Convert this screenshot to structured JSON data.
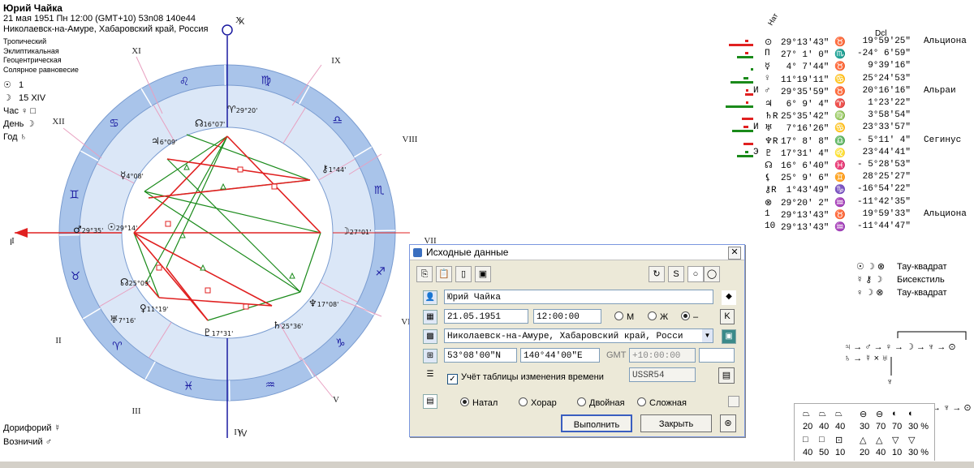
{
  "person": {
    "name": "Юрий Чайка",
    "datetime_line": "21 мая 1951  Пн  12:00 (GMT+10) 53n08  140e44",
    "place_line": "Николаевск-на-Амуре, Хабаровский край, Россия"
  },
  "settings": [
    "Тропический",
    "Эклиптикальная",
    "Геоцентрическая",
    "Солярное равновесие"
  ],
  "day_info": [
    {
      "glyph": "☉",
      "text": "1"
    },
    {
      "glyph": "☽",
      "text": "15 XIV"
    },
    {
      "label": "Час",
      "text": "♀ □"
    },
    {
      "label": "День",
      "text": "☽"
    },
    {
      "label": "Год",
      "text": "♄"
    }
  ],
  "bottom_left": [
    {
      "label": "Дорифорий",
      "glyph": "☿"
    },
    {
      "label": "Возничий",
      "glyph": "♂"
    }
  ],
  "chart": {
    "house_labels": [
      "X",
      "XI",
      "XII",
      "I",
      "II",
      "III",
      "IV",
      "V",
      "VI",
      "VII",
      "VIII",
      "IX"
    ],
    "zodiac": [
      "♉",
      "♈",
      "♓",
      "♒",
      "♑",
      "♐",
      "♏",
      "♎",
      "♍",
      "♌",
      "♋",
      "♊"
    ],
    "planet_labels": [
      {
        "glyph": "♈",
        "text": "29°20'"
      },
      {
        "glyph": "☊",
        "text": "16°07'"
      },
      {
        "glyph": "♃",
        "text": "6°09'"
      },
      {
        "glyph": "☿",
        "text": "4°08'"
      },
      {
        "glyph": "♂",
        "text": "29°35'"
      },
      {
        "glyph": "☉",
        "text": "29°14'"
      },
      {
        "glyph": "☊",
        "text": "25°09'"
      },
      {
        "glyph": "♅",
        "text": "7°16'"
      },
      {
        "glyph": "♀",
        "text": "11°19'"
      },
      {
        "glyph": "♇",
        "text": "17°31'"
      },
      {
        "glyph": "♄",
        "text": "25°36'"
      },
      {
        "glyph": "♆",
        "text": "17°08'"
      },
      {
        "glyph": "☽",
        "text": "27°01'"
      },
      {
        "glyph": "⚷",
        "text": "1°44'"
      }
    ],
    "axis_labels": {
      "x": "X",
      "i": "I",
      "iv": "IV",
      "vii": "VII"
    },
    "colors": {
      "ring": "#a9c4ea",
      "inner": "#dbe7f7",
      "hard": "#e02020",
      "soft": "#1a8a1a",
      "axis": "#1a1aa0",
      "asc": "#e02020"
    }
  },
  "table": {
    "header_nat": "Нат",
    "header_dcl": "Dcl",
    "rows": [
      {
        "mark": "",
        "glyph": "⊙",
        "pos": "29°13'43\" ♉",
        "dcl": " 19°59'25\"",
        "star": "Альциона",
        "bars": [
          {
            "c": "#e02020",
            "w": 30
          },
          {
            "c": "#e02020",
            "w": 4
          }
        ]
      },
      {
        "mark": "",
        "glyph": "Π",
        "pos": "27° 1' 0\" ♏",
        "dcl": "-24° 6'59\"",
        "star": "",
        "bars": [
          {
            "c": "#1a8a1a",
            "w": 20
          },
          {
            "c": "#e02020",
            "w": 4
          }
        ]
      },
      {
        "mark": "",
        "glyph": "☿",
        "pos": " 4° 7'44\" ♉",
        "dcl": "  9°39'16\"",
        "star": "",
        "bars": [
          {
            "c": "#1a8a1a",
            "w": 3
          }
        ]
      },
      {
        "mark": "",
        "glyph": "♀",
        "pos": "11°19'11\" ♋",
        "dcl": " 25°24'53\"",
        "star": "",
        "bars": [
          {
            "c": "#1a8a1a",
            "w": 28
          },
          {
            "c": "#1a8a1a",
            "w": 6
          }
        ]
      },
      {
        "mark": "И",
        "glyph": "♂",
        "pos": "29°35'59\" ♉",
        "dcl": " 20°16'16\"",
        "star": "Альраи",
        "bars": [
          {
            "c": "#e02020",
            "w": 10
          },
          {
            "c": "#e02020",
            "w": 3
          }
        ]
      },
      {
        "mark": "",
        "glyph": "♃",
        "pos": " 6° 9' 4\" ♈",
        "dcl": "  1°23'22\"",
        "star": "",
        "bars": [
          {
            "c": "#1a8a1a",
            "w": 34
          },
          {
            "c": "#e02020",
            "w": 3
          }
        ]
      },
      {
        "mark": "",
        "glyph": "♄R",
        "pos": "25°35'42\" ♍",
        "dcl": "  3°58'54\"",
        "star": "",
        "bars": [
          {
            "c": "#e02020",
            "w": 14
          }
        ]
      },
      {
        "mark": "И",
        "glyph": "♅",
        "pos": " 7°16'26\" ♋",
        "dcl": " 23°33'57\"",
        "star": "",
        "bars": [
          {
            "c": "#1a8a1a",
            "w": 26
          },
          {
            "c": "#e02020",
            "w": 6
          }
        ]
      },
      {
        "mark": "",
        "glyph": "♆R",
        "pos": "17° 8' 8\" ♎",
        "dcl": "- 5°11' 4\"",
        "star": "Сегинус",
        "bars": [
          {
            "c": "#e02020",
            "w": 12
          }
        ]
      },
      {
        "mark": "Э",
        "glyph": "♇",
        "pos": "17°31' 4\" ♌",
        "dcl": " 23°44'41\"",
        "star": "",
        "bars": [
          {
            "c": "#1a8a1a",
            "w": 20
          },
          {
            "c": "#1a8a1a",
            "w": 4
          }
        ]
      },
      {
        "mark": "",
        "glyph": "☊",
        "pos": "16° 6'40\" ♓",
        "dcl": "- 5°28'53\"",
        "star": "",
        "bars": []
      },
      {
        "mark": "",
        "glyph": "⚸",
        "pos": "25° 9' 6\" ♊",
        "dcl": " 28°25'27\"",
        "star": "",
        "bars": []
      },
      {
        "mark": "",
        "glyph": "⚷R",
        "pos": " 1°43'49\" ♑",
        "dcl": "-16°54'22\"",
        "star": "",
        "bars": []
      },
      {
        "mark": "",
        "glyph": "⊗",
        "pos": "29°20' 2\" ♒",
        "dcl": "-11°42'35\"",
        "star": "",
        "bars": []
      },
      {
        "mark": "",
        "glyph": "1",
        "pos": "29°13'43\" ♉",
        "dcl": " 19°59'33\"",
        "star": "Альциона",
        "bars": []
      },
      {
        "mark": "",
        "glyph": "10",
        "pos": "29°13'43\" ♒",
        "dcl": "-11°44'47\"",
        "star": "",
        "bars": []
      }
    ]
  },
  "aspect_configs": [
    {
      "glyphs": "☉ ☽ ⊗",
      "label": "Тау-квадрат"
    },
    {
      "glyphs": "☿ ⚷ ☽",
      "label": "Бисекстиль"
    },
    {
      "glyphs": "♀ ☽ ⊗",
      "label": "Тау-квадрат"
    }
  ],
  "dispositors": {
    "line1": "♃ → ♂ → ♀ → ☽ → ♆ → ⊙",
    "line2": "♄ → ☿ ×   ♅",
    "line3": "♆",
    "line4": "→ ♆ → ⊙"
  },
  "orb_table": {
    "row1_top": [
      "⏢",
      "⏢",
      "⏢",
      "⊖",
      "⊖",
      "◐",
      "◐"
    ],
    "row1_vals": [
      "20",
      "40",
      "40",
      "30",
      "70",
      "70",
      "30 %"
    ],
    "row2_top": [
      "□",
      "□",
      "⊡",
      "△",
      "△",
      "▽",
      "▽"
    ],
    "row2_vals": [
      "40",
      "50",
      "10",
      "20",
      "40",
      "10",
      "30 %"
    ]
  },
  "dialog": {
    "title": "Исходные данные",
    "name_value": "Юрий Чайка",
    "date_value": "21.05.1951",
    "time_value": "12:00:00",
    "sex_options": [
      "М",
      "Ж",
      "–"
    ],
    "sex_selected": 2,
    "k_button": "K",
    "place_value": "Николаевск-на-Амуре, Хабаровский край, Росси",
    "lat_value": "53°08'00\"N",
    "lon_value": "140°44'00\"E",
    "gmt_label": "GMT",
    "gmt_value": "+10:00:00",
    "timetable_check": "Учёт таблицы изменения времени",
    "timetable_value": "USSR54",
    "chart_types": [
      "Натал",
      "Хорар",
      "Двойная",
      "Сложная"
    ],
    "chart_type_selected": 0,
    "run_button": "Выполнить",
    "close_button": "Закрыть"
  }
}
